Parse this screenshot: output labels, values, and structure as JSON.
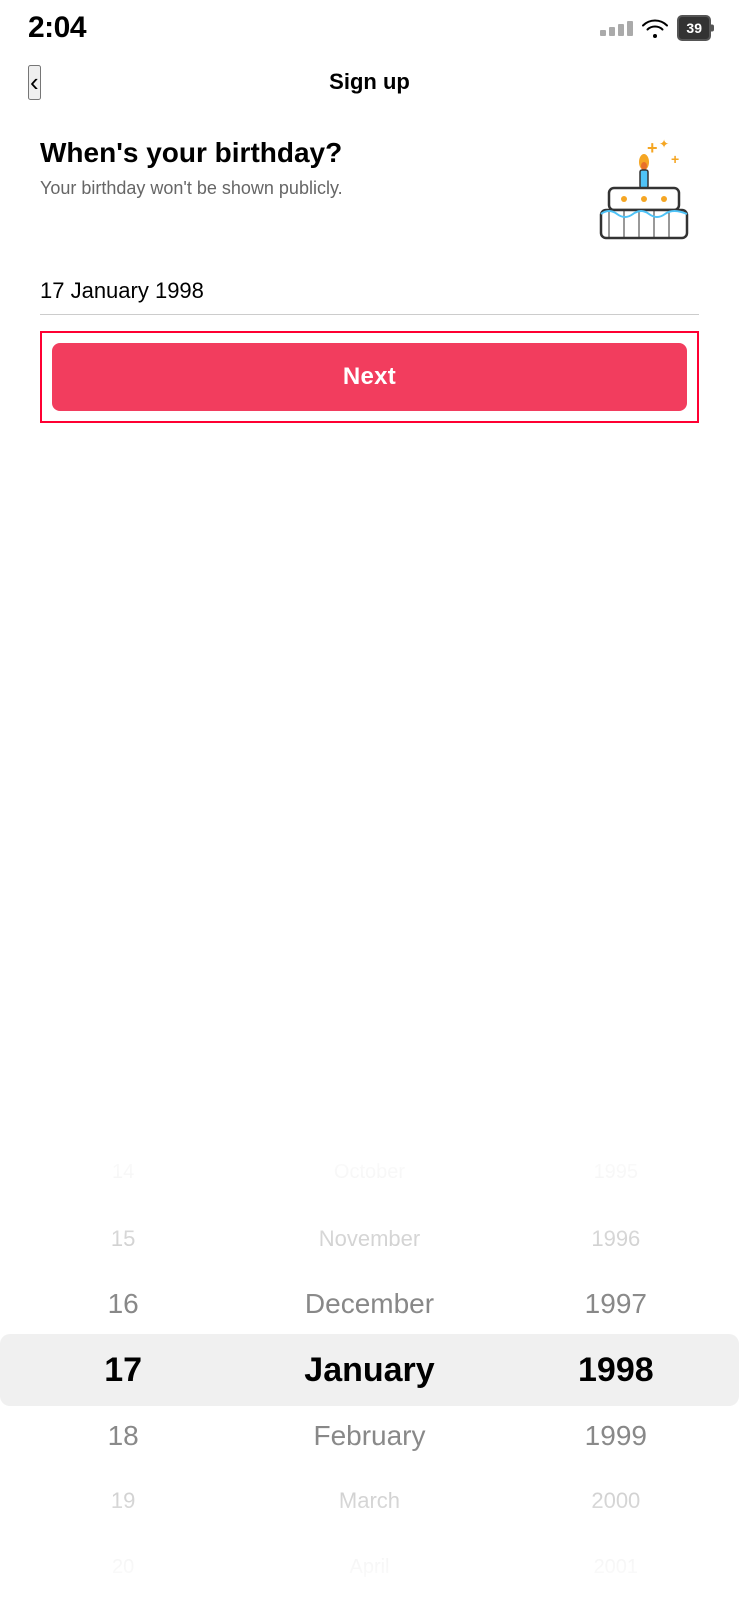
{
  "statusBar": {
    "time": "2:04",
    "batteryLevel": "39"
  },
  "header": {
    "backLabel": "‹",
    "title": "Sign up"
  },
  "birthdaySection": {
    "heading": "When's your birthday?",
    "subtext": "Your birthday won't be shown publicly."
  },
  "dateDisplay": {
    "value": "17 January 1998"
  },
  "nextButton": {
    "label": "Next"
  },
  "picker": {
    "days": {
      "items": [
        {
          "value": "14",
          "state": "farthest"
        },
        {
          "value": "15",
          "state": "far"
        },
        {
          "value": "16",
          "state": "near"
        },
        {
          "value": "17",
          "state": "selected"
        },
        {
          "value": "18",
          "state": "near"
        },
        {
          "value": "19",
          "state": "far"
        },
        {
          "value": "20",
          "state": "farthest"
        }
      ]
    },
    "months": {
      "items": [
        {
          "value": "October",
          "state": "farthest"
        },
        {
          "value": "November",
          "state": "far"
        },
        {
          "value": "December",
          "state": "near"
        },
        {
          "value": "January",
          "state": "selected"
        },
        {
          "value": "February",
          "state": "near"
        },
        {
          "value": "March",
          "state": "far"
        },
        {
          "value": "April",
          "state": "farthest"
        }
      ]
    },
    "years": {
      "items": [
        {
          "value": "1995",
          "state": "farthest"
        },
        {
          "value": "1996",
          "state": "far"
        },
        {
          "value": "1997",
          "state": "near"
        },
        {
          "value": "1998",
          "state": "selected"
        },
        {
          "value": "1999",
          "state": "near"
        },
        {
          "value": "2000",
          "state": "far"
        },
        {
          "value": "2001",
          "state": "farthest"
        }
      ]
    }
  }
}
